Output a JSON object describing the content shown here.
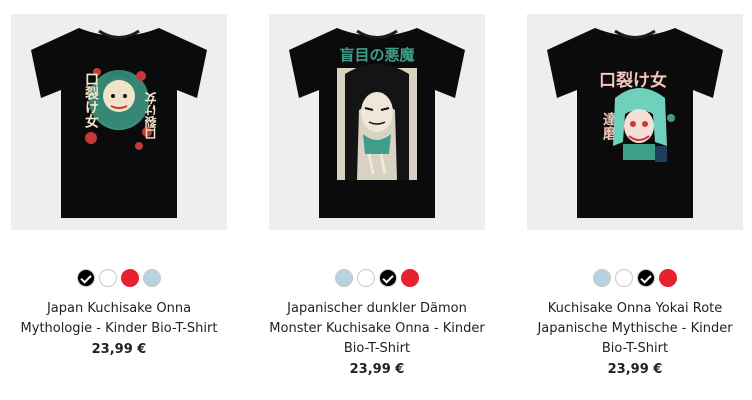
{
  "products": [
    {
      "title": "Japan Kuchisake Onna Mythologie - Kinder Bio-T-Shirt",
      "price": "23,99 €",
      "print_text_right": "口裂け女",
      "print_text_left": "口裂け女",
      "colors": [
        {
          "name": "black",
          "hex": "#000000",
          "selected": true
        },
        {
          "name": "white",
          "hex": "#ffffff",
          "selected": false
        },
        {
          "name": "red",
          "hex": "#e8202f",
          "selected": false
        },
        {
          "name": "light-blue",
          "hex": "#b8d3e0",
          "selected": false
        }
      ]
    },
    {
      "title": "Japanischer dunkler Dämon Monster Kuchisake Onna - Kinder Bio-T-Shirt",
      "price": "23,99 €",
      "print_text_top": "盲目の悪魔",
      "colors": [
        {
          "name": "light-blue",
          "hex": "#b8d3e0",
          "selected": false
        },
        {
          "name": "white",
          "hex": "#ffffff",
          "selected": false
        },
        {
          "name": "black",
          "hex": "#000000",
          "selected": true
        },
        {
          "name": "red",
          "hex": "#e8202f",
          "selected": false
        }
      ]
    },
    {
      "title": "Kuchisake Onna Yokai Rote Japanische Mythische - Kinder Bio-T-Shirt",
      "price": "23,99 €",
      "print_text_top": "口裂け女",
      "print_text_side": "達磨",
      "colors": [
        {
          "name": "light-blue",
          "hex": "#b8d3e0",
          "selected": false
        },
        {
          "name": "white",
          "hex": "#ffffff",
          "selected": false
        },
        {
          "name": "black",
          "hex": "#000000",
          "selected": true
        },
        {
          "name": "red",
          "hex": "#e8202f",
          "selected": false
        }
      ]
    }
  ],
  "palette": {
    "shirt": "#0b0b0b",
    "image_bg": "#eeeeee",
    "print_teal": "#3f9e8a",
    "print_cream": "#f1e3c8",
    "print_red": "#c43a3a",
    "print_pink": "#f3c7bd"
  }
}
